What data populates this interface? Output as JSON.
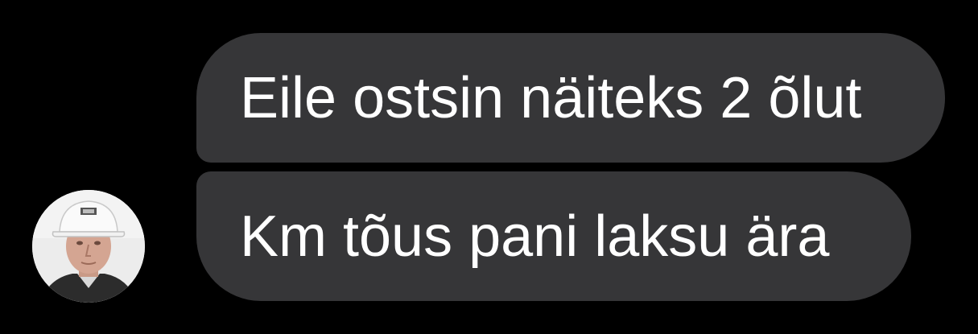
{
  "conversation": {
    "messages": [
      {
        "text": "Eile ostsin näiteks 2 õlut"
      },
      {
        "text": "Km tõus pani laksu ära"
      }
    ],
    "sender": {
      "avatar_icon": "user-avatar-photo"
    }
  },
  "colors": {
    "background": "#000000",
    "bubble": "#363638",
    "text": "#ffffff"
  }
}
